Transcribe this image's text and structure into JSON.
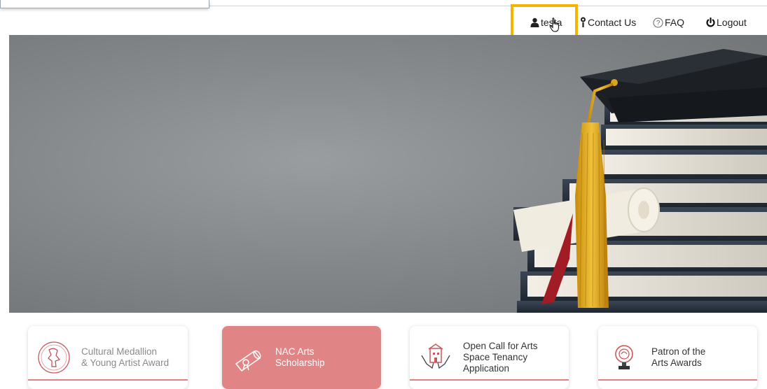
{
  "header": {
    "user": {
      "label": "testa",
      "icon": "user-icon"
    },
    "contact": {
      "label": "Contact Us",
      "icon": "contact-person-icon"
    },
    "faq": {
      "label": "FAQ",
      "icon": "question-circle-icon"
    },
    "logout": {
      "label": "Logout",
      "icon": "power-icon"
    }
  },
  "hero": {
    "image": "graduation-cap-books-diploma"
  },
  "cards": [
    {
      "line1": "Cultural Medallion",
      "line2": "& Young Artist Award",
      "line3": "",
      "icon": "medallion-icon"
    },
    {
      "line1": "NAC Arts",
      "line2": "Scholarship",
      "line3": "",
      "icon": "diploma-scroll-icon"
    },
    {
      "line1": "Open Call for Arts",
      "line2": "Space Tenancy",
      "line3": "Application",
      "icon": "hands-building-icon"
    },
    {
      "line1": "Patron of the",
      "line2": "Arts Awards",
      "line3": "",
      "icon": "trophy-icon"
    }
  ],
  "colors": {
    "accent": "#e08486",
    "highlight": "#f4b400"
  }
}
